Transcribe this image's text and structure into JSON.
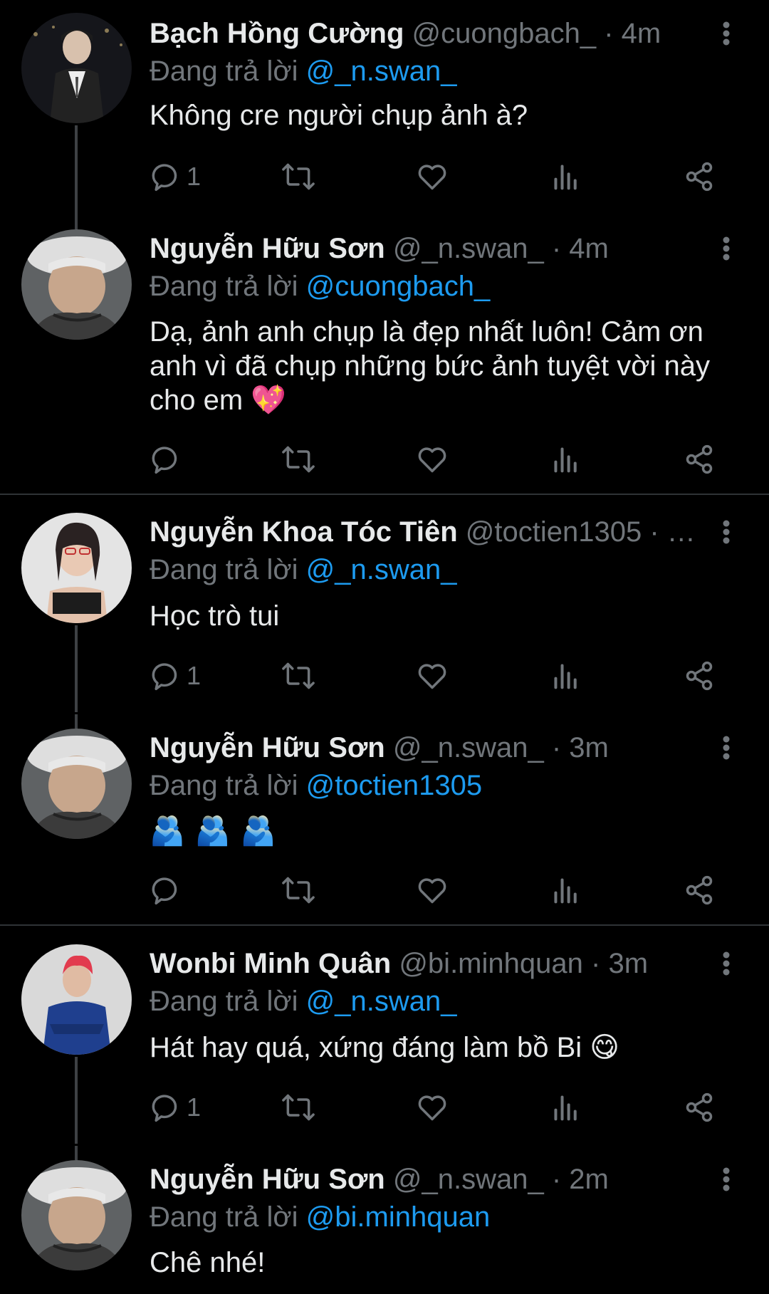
{
  "tweets": [
    {
      "name": "Bạch Hồng Cường",
      "handle": "@cuongbach_",
      "sep": "·",
      "time": "4m",
      "replying_prefix": "Đang trả lời",
      "replying_to": "@_n.swan_",
      "text": "Không cre người chụp ảnh à?",
      "reply_count": "1",
      "avatar": {
        "desc": "man in suit vest, night background",
        "bg": "#1a1a1f",
        "fg": "#d9c8b8"
      }
    },
    {
      "name": "Nguyễn Hữu Sơn",
      "handle": "@_n.swan_",
      "sep": "·",
      "time": "4m",
      "replying_prefix": "Đang trả lời",
      "replying_to": "@cuongbach_",
      "text": "Dạ, ảnh anh chụp là đẹp nhất luôn! Cảm ơn anh vì đã chụp những bức ảnh tuyệt vời này cho em 💖",
      "reply_count": "",
      "avatar": {
        "desc": "young man with bucket hat",
        "bg": "#6b6d6e",
        "fg": "#c9a98f"
      }
    },
    {
      "name": "Nguyễn Khoa Tóc Tiên",
      "handle": "@toctien1305",
      "sep": "· …",
      "time": "",
      "replying_prefix": "Đang trả lời",
      "replying_to": "@_n.swan_",
      "text": "Học trò tui",
      "reply_count": "1",
      "avatar": {
        "desc": "woman in black top, light background",
        "bg": "#e6e6e6",
        "fg": "#2b2b2b"
      }
    },
    {
      "name": "Nguyễn Hữu Sơn",
      "handle": "@_n.swan_",
      "sep": "·",
      "time": "3m",
      "replying_prefix": "Đang trả lời",
      "replying_to": "@toctien1305",
      "text": "🫂🫂🫂",
      "reply_count": "",
      "avatar": {
        "desc": "young man with bucket hat",
        "bg": "#6b6d6e",
        "fg": "#c9a98f"
      }
    },
    {
      "name": "Wonbi Minh Quân",
      "handle": "@bi.minhquan",
      "sep": "·",
      "time": "3m",
      "replying_prefix": "Đang trả lời",
      "replying_to": "@_n.swan_",
      "text": "Hát hay quá, xứng đáng làm bồ Bi 😋",
      "reply_count": "1",
      "avatar": {
        "desc": "man with red hair in blue jacket",
        "bg": "#dcdcdc",
        "fg": "#1e3f8f"
      }
    },
    {
      "name": "Nguyễn Hữu Sơn",
      "handle": "@_n.swan_",
      "sep": "·",
      "time": "2m",
      "replying_prefix": "Đang trả lời",
      "replying_to": "@bi.minhquan",
      "text": "Chê nhé!",
      "reply_count": "",
      "avatar": {
        "desc": "young man with bucket hat",
        "bg": "#6b6d6e",
        "fg": "#c9a98f"
      }
    }
  ],
  "icons": {
    "reply": "reply-icon",
    "retweet": "retweet-icon",
    "like": "like-icon",
    "views": "views-icon",
    "share": "share-icon",
    "more": "more-vertical-icon"
  },
  "colors": {
    "background": "#000000",
    "text": "#e7e9ea",
    "muted": "#71767b",
    "link": "#1d9bf0",
    "divider": "#2f3336"
  }
}
